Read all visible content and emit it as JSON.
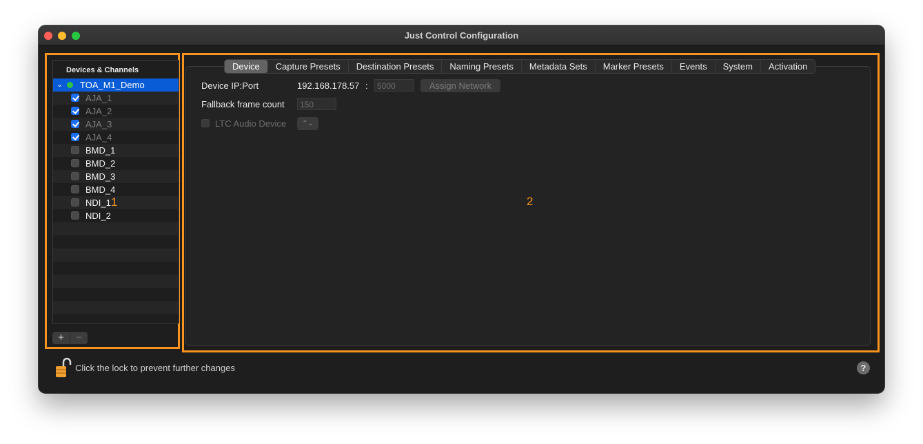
{
  "window": {
    "title": "Just Control Configuration"
  },
  "sidebar": {
    "header": "Devices & Channels",
    "root": {
      "label": "TOA_M1_Demo",
      "status_color": "#30c24a"
    },
    "channels": [
      {
        "label": "AJA_1",
        "checked": true,
        "dim": true
      },
      {
        "label": "AJA_2",
        "checked": true,
        "dim": true
      },
      {
        "label": "AJA_3",
        "checked": true,
        "dim": true
      },
      {
        "label": "AJA_4",
        "checked": true,
        "dim": true
      },
      {
        "label": "BMD_1",
        "checked": false,
        "dim": false
      },
      {
        "label": "BMD_2",
        "checked": false,
        "dim": false
      },
      {
        "label": "BMD_3",
        "checked": false,
        "dim": false
      },
      {
        "label": "BMD_4",
        "checked": false,
        "dim": false
      },
      {
        "label": "NDI_1",
        "checked": false,
        "dim": false
      },
      {
        "label": "NDI_2",
        "checked": false,
        "dim": false
      }
    ],
    "add_label": "+",
    "remove_label": "−"
  },
  "tabs": [
    "Device",
    "Capture Presets",
    "Destination Presets",
    "Naming Presets",
    "Metadata Sets",
    "Marker Presets",
    "Events",
    "System",
    "Activation"
  ],
  "active_tab": "Device",
  "device": {
    "ip_label": "Device IP:Port",
    "ip_value": "192.168.178.57",
    "separator": ":",
    "port_value": "5000",
    "assign_button": "Assign Network",
    "fallback_label": "Fallback frame count",
    "fallback_value": "150",
    "ltc_label": "LTC Audio Device",
    "ltc_popup_icon": "⌃⌄"
  },
  "markers": {
    "panel1": "1",
    "panel2": "2"
  },
  "footer": {
    "lock_text": "Click the lock to prevent further changes",
    "help_label": "?"
  },
  "colors": {
    "accent_highlight": "#f7931e",
    "selection": "#0a5bd6"
  }
}
